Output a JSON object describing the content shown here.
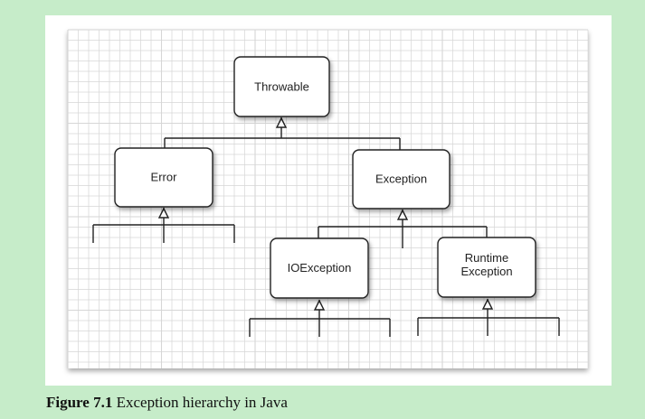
{
  "diagram": {
    "nodes": [
      {
        "id": "throwable",
        "lines": [
          "Throwable"
        ]
      },
      {
        "id": "error",
        "lines": [
          "Error"
        ]
      },
      {
        "id": "exception",
        "lines": [
          "Exception"
        ]
      },
      {
        "id": "ioexception",
        "lines": [
          "IOException"
        ]
      },
      {
        "id": "runtime",
        "lines": [
          "Runtime",
          "Exception"
        ]
      }
    ],
    "edges": [
      {
        "from": "error",
        "to": "throwable"
      },
      {
        "from": "exception",
        "to": "throwable"
      },
      {
        "from": "ioexception",
        "to": "exception"
      },
      {
        "from": "runtime",
        "to": "exception"
      }
    ]
  },
  "caption": {
    "label": "Figure 7.1",
    "text": "Exception hierarchy in Java"
  },
  "colors": {
    "background": "#c6ecc9",
    "grid": "#d6d6d6",
    "box_stroke": "#222222"
  }
}
